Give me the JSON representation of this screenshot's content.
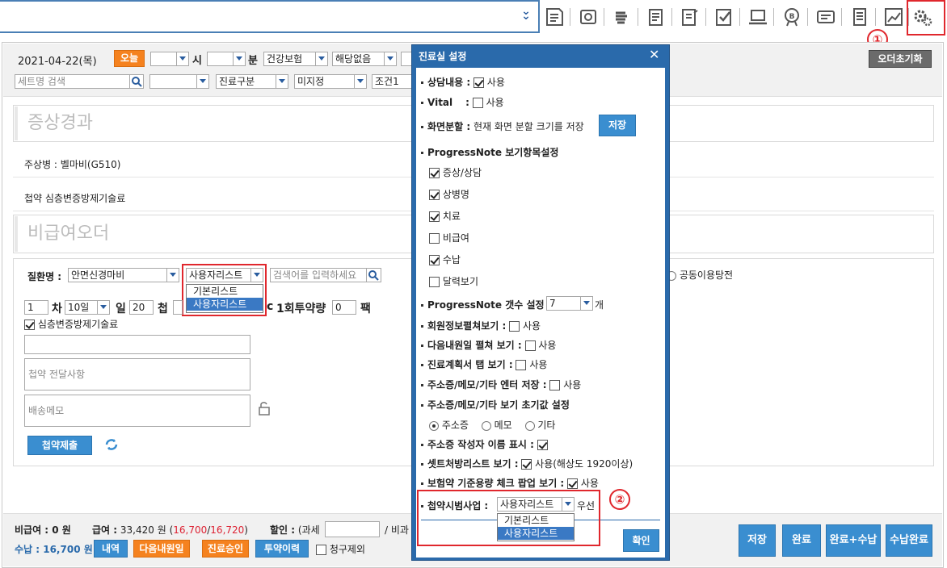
{
  "header": {
    "toolbar_icons": [
      "memo-icon",
      "camera-icon",
      "hand-icon",
      "checklist-icon",
      "clipboard-edit-icon",
      "check-clipboard-icon",
      "laptop-icon",
      "badge-b-icon",
      "card-icon",
      "document-icon",
      "chart-icon",
      "settings-icon"
    ]
  },
  "annotations": {
    "step1": "①",
    "step2": "②"
  },
  "order_bar": {
    "date": "2021-04-22(목)",
    "today_btn": "오늘",
    "hour_label": "시",
    "minute_label": "분",
    "insurance": "건강보험",
    "applicable": "해당없음",
    "reset_btn": "오더초기화",
    "set_search_placeholder": "세트명 검색",
    "treatment_type": "진료구분",
    "undecided": "미지정",
    "condition": "조건1"
  },
  "symptoms": {
    "title": "증상경과",
    "main_disease_label": "주상병 : ",
    "main_disease_value": "벨마비(G510)",
    "herbal": "첩약 심층변증방제기술료"
  },
  "nonbenefit": {
    "title": "비급여오더",
    "disease_label": "질환명 :",
    "disease_value": "안면신경마비",
    "user_list": "사용자리스트",
    "search_placeholder": "검색어를 입력하세요",
    "dropdown_options": [
      "기본리스트",
      "사용자리스트"
    ],
    "shared_option": "공동이용탕전",
    "count": "1",
    "cha_label": "차",
    "days_select": "10일",
    "il_label": "일",
    "cheop_count": "20",
    "cheop_label": "첩",
    "cc_label": "c",
    "dose_label": "1회투약량",
    "dose_value": "0",
    "pack_label": "팩",
    "herbal_check": "심층변증방제기술료",
    "delivery_note_placeholder": "첩약 전달사항",
    "shipping_memo_placeholder": "배송메모",
    "submit_btn": "첩약제출"
  },
  "footer": {
    "nonbenefit": "비급여 : 0 원",
    "benefit_label": "급여 :",
    "benefit_value": "33,420 원",
    "benefit_detail_open": "(",
    "benefit_part1": "16,700",
    "benefit_slash": "/",
    "benefit_part2": "16,720",
    "benefit_detail_close": ")",
    "discount_label": "할인 :",
    "discount_taxed": "(과세",
    "discount_nontaxed": "/ 비과",
    "payment": "수납 : 16,700 원",
    "btn_history": "내역",
    "btn_next_visit": "다음내원일",
    "btn_approve": "진료승인",
    "btn_medication": "투약이력",
    "exclude_claim": "청구제외",
    "btn_save": "저장",
    "btn_complete": "완료",
    "btn_complete_pay": "완료+수납",
    "btn_pay_complete": "수납완료"
  },
  "modal": {
    "title": "진료실 설정",
    "close": "✕",
    "counsel_label": "상담내용 :",
    "use": "사용",
    "vital_label": "Vital",
    "vital_colon": ":",
    "split_label": "화면분할 :",
    "split_desc": "현재 화면 분할 크기를 저장",
    "save_btn": "저장",
    "progress_label": "ProgressNote 보기항목설정",
    "progress_items": [
      {
        "label": "증상/상담",
        "checked": true
      },
      {
        "label": "상병명",
        "checked": true
      },
      {
        "label": "치료",
        "checked": true
      },
      {
        "label": "비급여",
        "checked": false
      },
      {
        "label": "수납",
        "checked": true
      },
      {
        "label": "달력보기",
        "checked": false
      }
    ],
    "progress_count_label": "ProgressNote 갯수 설정 :",
    "progress_count_value": "7",
    "progress_count_unit": "개",
    "member_info_label": "회원정보펼쳐보기 :",
    "next_visit_label": "다음내원일 펼쳐 보기 :",
    "plan_tab_label": "진료계획서 탭 보기 :",
    "enter_save_label": "주소증/메모/기타 엔터 저장 :",
    "default_view_label": "주소증/메모/기타 보기 초기값 설정",
    "radio_options": [
      "주소증",
      "메모",
      "기타"
    ],
    "author_label": "주소증 작성자 이름 표시 :",
    "set_list_label": "셋트처방리스트 보기 :",
    "set_list_desc": "사용(해상도 1920이상)",
    "dose_check_label": "보험약 기준용량 체크 팝업 보기 :",
    "pilot_label": "첩약시범사업 :",
    "pilot_value": "사용자리스트",
    "pilot_priority": "우선",
    "pilot_options": [
      "기본리스트",
      "사용자리스트"
    ],
    "confirm_btn": "확인"
  }
}
